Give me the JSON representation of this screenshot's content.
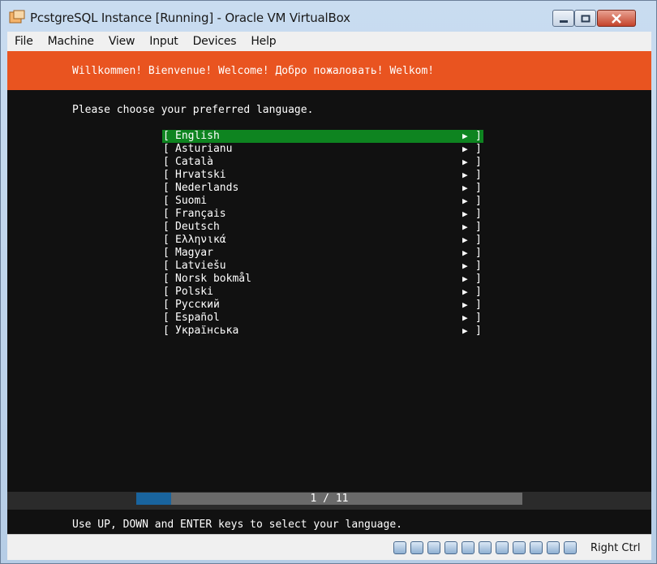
{
  "window": {
    "title": "PcstgreSQL Instance [Running] - Oracle VM VirtualBox"
  },
  "menu": [
    "File",
    "Machine",
    "View",
    "Input",
    "Devices",
    "Help"
  ],
  "installer": {
    "banner": "Willkommen! Bienvenue! Welcome! Добро пожаловать! Welkom!",
    "prompt": "Please choose your preferred language.",
    "languages": [
      "English",
      "Asturianu",
      "Català",
      "Hrvatski",
      "Nederlands",
      "Suomi",
      "Français",
      "Deutsch",
      "Ελληνικά",
      "Magyar",
      "Latviešu",
      "Norsk bokmål",
      "Polski",
      "Русский",
      "Español",
      "Українська"
    ],
    "selected_index": 0,
    "bracket_open": "[",
    "bracket_close": "]",
    "arrow": "▶",
    "page_indicator": "1 / 11",
    "progress_fraction": 0.0909,
    "hint": "Use UP, DOWN and ENTER keys to select your language."
  },
  "statusbar": {
    "host_key": "Right Ctrl",
    "icons": [
      "hard-disk-icon",
      "optical-drive-icon",
      "audio-icon",
      "network-icon",
      "usb-icon",
      "shared-folders-icon",
      "display-icon",
      "video-capture-icon",
      "cpu-icon",
      "mouse-integration-icon",
      "keyboard-capture-icon"
    ]
  },
  "colors": {
    "banner": "#e95420",
    "selection": "#0e8420",
    "progress_fill": "#19649e",
    "terminal_bg": "#111111"
  }
}
